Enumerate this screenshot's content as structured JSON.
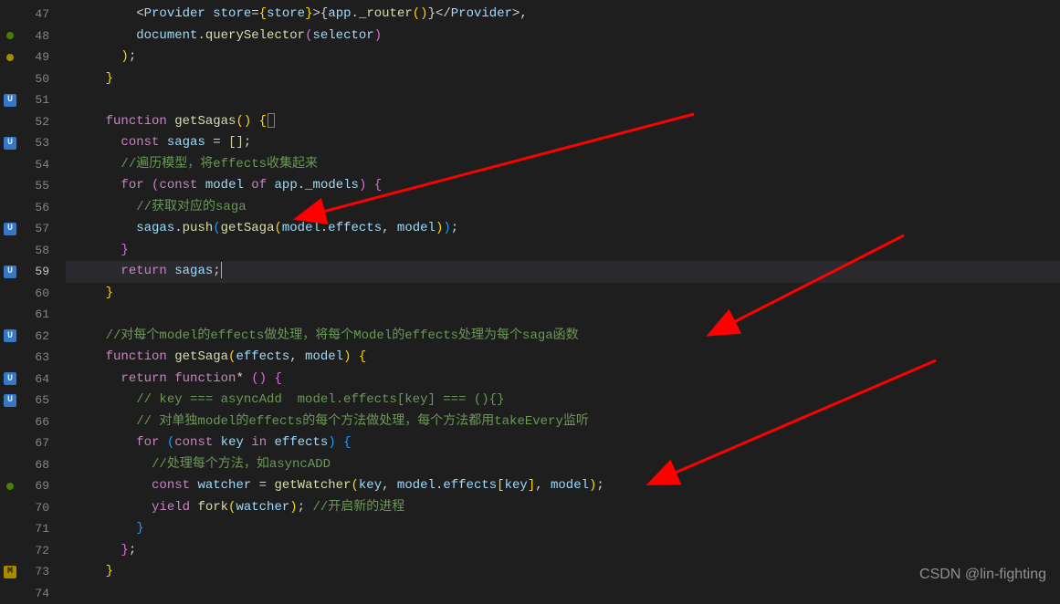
{
  "watermark": "CSDN @lin-fighting",
  "gutterMarkers": [
    "",
    "dot-green",
    "dot-yellow",
    "",
    "U",
    "",
    "U",
    "",
    "",
    "",
    "U",
    "",
    "U",
    "",
    "",
    "U",
    "",
    "U",
    "U",
    "",
    "",
    "",
    "dot-green",
    "",
    "",
    "",
    "M",
    ""
  ],
  "lineNumbers": [
    47,
    48,
    49,
    50,
    51,
    52,
    53,
    54,
    55,
    56,
    57,
    58,
    59,
    60,
    61,
    62,
    63,
    64,
    65,
    66,
    67,
    68,
    69,
    70,
    71,
    72,
    73,
    74
  ],
  "activeLine": 59,
  "code": {
    "l47": "        <Provider store={store}>{app._router()}</Provider>,",
    "l48_doc": "document",
    "l48_qs": "querySelector",
    "l48_sel": "selector",
    "l52_fn": "function",
    "l52_name": "getSagas",
    "l53_const": "const",
    "l53_sagas": "sagas",
    "l54_cmt": "//遍历模型，将effects收集起来",
    "l55_for": "for",
    "l55_const": "const",
    "l55_model": "model",
    "l55_of": "of",
    "l55_app": "app",
    "l55_models": "_models",
    "l56_cmt": "//获取对应的saga",
    "l57_sagas": "sagas",
    "l57_push": "push",
    "l57_getSaga": "getSaga",
    "l57_model": "model",
    "l57_effects": "effects",
    "l57_model2": "model",
    "l59_return": "return",
    "l59_sagas": "sagas",
    "l62_cmt": "//对每个model的effects做处理，将每个Model的effects处理为每个saga函数",
    "l63_fn": "function",
    "l63_name": "getSaga",
    "l63_effects": "effects",
    "l63_model": "model",
    "l64_return": "return",
    "l64_fn": "function",
    "l65_cmt": "// key === asyncAdd  model.effects[key] === (){}",
    "l66_cmt": "// 对单独model的effects的每个方法做处理，每个方法都用takeEvery监听",
    "l67_for": "for",
    "l67_const": "const",
    "l67_key": "key",
    "l67_in": "in",
    "l67_effects": "effects",
    "l68_cmt": "//处理每个方法，如asyncADD",
    "l69_const": "const",
    "l69_watcher": "watcher",
    "l69_getWatcher": "getWatcher",
    "l69_key": "key",
    "l69_model": "model",
    "l69_effects": "effects",
    "l69_key2": "key",
    "l69_model2": "model",
    "l70_yield": "yield",
    "l70_fork": "fork",
    "l70_watcher": "watcher",
    "l70_cmt": "//开启新的进程"
  }
}
